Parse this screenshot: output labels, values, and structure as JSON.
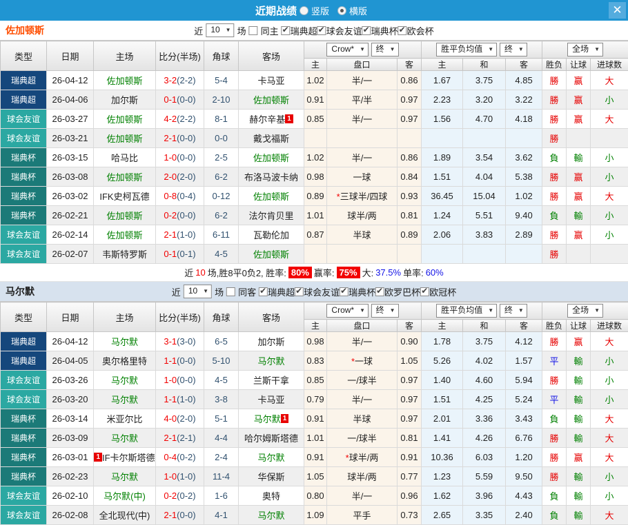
{
  "titlebar": {
    "title": "近期战绩",
    "vertical_label": "竖版",
    "horizontal_label": "横版",
    "selected_layout": "横版"
  },
  "icons": {
    "close": "✕",
    "dropdown": "▼"
  },
  "table_header": {
    "type": "类型",
    "date": "日期",
    "home": "主场",
    "score_half": "比分(半场)",
    "corner": "角球",
    "away": "客场",
    "sub_home": "主",
    "sub_handicap": "盘口",
    "sub_away": "客",
    "sub_avg_home": "主",
    "sub_avg_draw": "和",
    "sub_avg_away": "客",
    "sub_result": "胜负",
    "sub_let": "让球",
    "sub_goals": "进球数"
  },
  "dropdowns": {
    "crow": "Crow*",
    "final": "终",
    "avg": "胜平负均值",
    "full": "全场"
  },
  "type_colors": {
    "瑞典超": "#15477C",
    "球会友谊": "#2BA8A2",
    "瑞典杯": "#1B7A78"
  },
  "result_colors": {
    "勝": "#E60000",
    "平": "#1414E6",
    "負": "#008000",
    "赢": "#E60000",
    "輸": "#008000",
    "大": "#E60000",
    "小": "#008000"
  },
  "sections": [
    {
      "team": "佐加顿斯",
      "filter": {
        "prefix": "近",
        "count": "10",
        "suffix": "场",
        "same_label": "同主",
        "same_checked": false,
        "leagues": [
          {
            "label": "瑞典超",
            "checked": true
          },
          {
            "label": "球会友谊",
            "checked": true
          },
          {
            "label": "瑞典杯",
            "checked": true
          },
          {
            "label": "欧会杯",
            "checked": true
          }
        ]
      },
      "rows": [
        {
          "type": "瑞典超",
          "date": "26-04-12",
          "home": "佐加顿斯",
          "home_green": true,
          "home_badge": "",
          "home_badge_before": false,
          "score": "3-2",
          "half": "(2-2)",
          "corner": "5-4",
          "away": "卡马亚",
          "away_green": false,
          "away_badge": "",
          "odds_home": "1.02",
          "handicap": "半/一",
          "handicap_star": false,
          "odds_away": "0.86",
          "avg_home": "1.67",
          "avg_draw": "3.75",
          "avg_away": "4.85",
          "res_win": "勝",
          "res_let": "赢",
          "res_goals": "大"
        },
        {
          "type": "瑞典超",
          "date": "26-04-06",
          "home": "加尔斯",
          "home_green": false,
          "home_badge": "",
          "home_badge_before": false,
          "score": "0-1",
          "half": "(0-0)",
          "corner": "2-10",
          "away": "佐加顿斯",
          "away_green": true,
          "away_badge": "",
          "odds_home": "0.91",
          "handicap": "平/半",
          "handicap_star": false,
          "odds_away": "0.97",
          "avg_home": "2.23",
          "avg_draw": "3.20",
          "avg_away": "3.22",
          "res_win": "勝",
          "res_let": "赢",
          "res_goals": "小"
        },
        {
          "type": "球会友谊",
          "date": "26-03-27",
          "home": "佐加顿斯",
          "home_green": true,
          "home_badge": "",
          "home_badge_before": false,
          "score": "4-2",
          "half": "(2-2)",
          "corner": "8-1",
          "away": "赫尔辛基",
          "away_green": false,
          "away_badge": "1",
          "odds_home": "0.85",
          "handicap": "半/一",
          "handicap_star": false,
          "odds_away": "0.97",
          "avg_home": "1.56",
          "avg_draw": "4.70",
          "avg_away": "4.18",
          "res_win": "勝",
          "res_let": "赢",
          "res_goals": "大"
        },
        {
          "type": "球会友谊",
          "date": "26-03-21",
          "home": "佐加顿斯",
          "home_green": true,
          "home_badge": "",
          "home_badge_before": false,
          "score": "2-1",
          "half": "(0-0)",
          "corner": "0-0",
          "away": "戴戈福斯",
          "away_green": false,
          "away_badge": "",
          "odds_home": "",
          "handicap": "",
          "handicap_star": false,
          "odds_away": "",
          "avg_home": "",
          "avg_draw": "",
          "avg_away": "",
          "res_win": "勝",
          "res_let": "",
          "res_goals": ""
        },
        {
          "type": "瑞典杯",
          "date": "26-03-15",
          "home": "哈马比",
          "home_green": false,
          "home_badge": "",
          "home_badge_before": false,
          "score": "1-0",
          "half": "(0-0)",
          "corner": "2-5",
          "away": "佐加顿斯",
          "away_green": true,
          "away_badge": "",
          "odds_home": "1.02",
          "handicap": "半/一",
          "handicap_star": false,
          "odds_away": "0.86",
          "avg_home": "1.89",
          "avg_draw": "3.54",
          "avg_away": "3.62",
          "res_win": "負",
          "res_let": "輸",
          "res_goals": "小"
        },
        {
          "type": "瑞典杯",
          "date": "26-03-08",
          "home": "佐加顿斯",
          "home_green": true,
          "home_badge": "",
          "home_badge_before": false,
          "score": "2-0",
          "half": "(2-0)",
          "corner": "6-2",
          "away": "布洛马波卡纳",
          "away_green": false,
          "away_badge": "",
          "odds_home": "0.98",
          "handicap": "一球",
          "handicap_star": false,
          "odds_away": "0.84",
          "avg_home": "1.51",
          "avg_draw": "4.04",
          "avg_away": "5.38",
          "res_win": "勝",
          "res_let": "赢",
          "res_goals": "小"
        },
        {
          "type": "瑞典杯",
          "date": "26-03-02",
          "home": "IFK史柯瓦德",
          "home_green": false,
          "home_badge": "",
          "home_badge_before": false,
          "score": "0-8",
          "half": "(0-4)",
          "corner": "0-12",
          "away": "佐加顿斯",
          "away_green": true,
          "away_badge": "",
          "odds_home": "0.89",
          "handicap": "三球半/四球",
          "handicap_star": true,
          "odds_away": "0.93",
          "avg_home": "36.45",
          "avg_draw": "15.04",
          "avg_away": "1.02",
          "res_win": "勝",
          "res_let": "赢",
          "res_goals": "大"
        },
        {
          "type": "瑞典杯",
          "date": "26-02-21",
          "home": "佐加顿斯",
          "home_green": true,
          "home_badge": "",
          "home_badge_before": false,
          "score": "0-2",
          "half": "(0-0)",
          "corner": "6-2",
          "away": "法尔肯贝里",
          "away_green": false,
          "away_badge": "",
          "odds_home": "1.01",
          "handicap": "球半/两",
          "handicap_star": false,
          "odds_away": "0.81",
          "avg_home": "1.24",
          "avg_draw": "5.51",
          "avg_away": "9.40",
          "res_win": "負",
          "res_let": "輸",
          "res_goals": "小"
        },
        {
          "type": "球会友谊",
          "date": "26-02-14",
          "home": "佐加顿斯",
          "home_green": true,
          "home_badge": "",
          "home_badge_before": false,
          "score": "2-1",
          "half": "(1-0)",
          "corner": "6-11",
          "away": "瓦勒伦加",
          "away_green": false,
          "away_badge": "",
          "odds_home": "0.87",
          "handicap": "半球",
          "handicap_star": false,
          "odds_away": "0.89",
          "avg_home": "2.06",
          "avg_draw": "3.83",
          "avg_away": "2.89",
          "res_win": "勝",
          "res_let": "赢",
          "res_goals": "小"
        },
        {
          "type": "球会友谊",
          "date": "26-02-07",
          "home": "韦斯特罗斯",
          "home_green": false,
          "home_badge": "",
          "home_badge_before": false,
          "score": "0-1",
          "half": "(0-1)",
          "corner": "4-5",
          "away": "佐加顿斯",
          "away_green": true,
          "away_badge": "",
          "odds_home": "",
          "handicap": "",
          "handicap_star": false,
          "odds_away": "",
          "avg_home": "",
          "avg_draw": "",
          "avg_away": "",
          "res_win": "勝",
          "res_let": "",
          "res_goals": ""
        }
      ],
      "summary": {
        "t1": "近",
        "n1": "10",
        "t2": "场,胜8平0负2, 胜率:",
        "rate1": "80%",
        "t3": "赢率:",
        "rate2": "75%",
        "t4": "大:",
        "big": "37.5%",
        "t5": "单率:",
        "single": "60%"
      }
    },
    {
      "team": "马尔默",
      "filter": {
        "prefix": "近",
        "count": "10",
        "suffix": "场",
        "same_label": "同客",
        "same_checked": false,
        "leagues": [
          {
            "label": "瑞典超",
            "checked": true
          },
          {
            "label": "球会友谊",
            "checked": true
          },
          {
            "label": "瑞典杯",
            "checked": true
          },
          {
            "label": "欧罗巴杯",
            "checked": true
          },
          {
            "label": "欧冠杯",
            "checked": true
          }
        ]
      },
      "rows": [
        {
          "type": "瑞典超",
          "date": "26-04-12",
          "home": "马尔默",
          "home_green": true,
          "home_badge": "",
          "home_badge_before": false,
          "score": "3-1",
          "half": "(3-0)",
          "corner": "6-5",
          "away": "加尔斯",
          "away_green": false,
          "away_badge": "",
          "odds_home": "0.98",
          "handicap": "半/一",
          "handicap_star": false,
          "odds_away": "0.90",
          "avg_home": "1.78",
          "avg_draw": "3.75",
          "avg_away": "4.12",
          "res_win": "勝",
          "res_let": "赢",
          "res_goals": "大"
        },
        {
          "type": "瑞典超",
          "date": "26-04-05",
          "home": "奥尔格里特",
          "home_green": false,
          "home_badge": "",
          "home_badge_before": false,
          "score": "1-1",
          "half": "(0-0)",
          "corner": "5-10",
          "away": "马尔默",
          "away_green": true,
          "away_badge": "",
          "odds_home": "0.83",
          "handicap": "一球",
          "handicap_star": true,
          "odds_away": "1.05",
          "avg_home": "5.26",
          "avg_draw": "4.02",
          "avg_away": "1.57",
          "res_win": "平",
          "res_let": "輸",
          "res_goals": "小"
        },
        {
          "type": "球会友谊",
          "date": "26-03-26",
          "home": "马尔默",
          "home_green": true,
          "home_badge": "",
          "home_badge_before": false,
          "score": "1-0",
          "half": "(0-0)",
          "corner": "4-5",
          "away": "兰斯干拿",
          "away_green": false,
          "away_badge": "",
          "odds_home": "0.85",
          "handicap": "一/球半",
          "handicap_star": false,
          "odds_away": "0.97",
          "avg_home": "1.40",
          "avg_draw": "4.60",
          "avg_away": "5.94",
          "res_win": "勝",
          "res_let": "輸",
          "res_goals": "小"
        },
        {
          "type": "球会友谊",
          "date": "26-03-20",
          "home": "马尔默",
          "home_green": true,
          "home_badge": "",
          "home_badge_before": false,
          "score": "1-1",
          "half": "(1-0)",
          "corner": "3-8",
          "away": "卡马亚",
          "away_green": false,
          "away_badge": "",
          "odds_home": "0.79",
          "handicap": "半/一",
          "handicap_star": false,
          "odds_away": "0.97",
          "avg_home": "1.51",
          "avg_draw": "4.25",
          "avg_away": "5.24",
          "res_win": "平",
          "res_let": "輸",
          "res_goals": "小"
        },
        {
          "type": "瑞典杯",
          "date": "26-03-14",
          "home": "米亚尔比",
          "home_green": false,
          "home_badge": "",
          "home_badge_before": false,
          "score": "4-0",
          "half": "(2-0)",
          "corner": "5-1",
          "away": "马尔默",
          "away_green": true,
          "away_badge": "1",
          "odds_home": "0.91",
          "handicap": "半球",
          "handicap_star": false,
          "odds_away": "0.97",
          "avg_home": "2.01",
          "avg_draw": "3.36",
          "avg_away": "3.43",
          "res_win": "負",
          "res_let": "輸",
          "res_goals": "大"
        },
        {
          "type": "瑞典杯",
          "date": "26-03-09",
          "home": "马尔默",
          "home_green": true,
          "home_badge": "",
          "home_badge_before": false,
          "score": "2-1",
          "half": "(2-1)",
          "corner": "4-4",
          "away": "哈尔姆斯塔德",
          "away_green": false,
          "away_badge": "",
          "odds_home": "1.01",
          "handicap": "一/球半",
          "handicap_star": false,
          "odds_away": "0.81",
          "avg_home": "1.41",
          "avg_draw": "4.26",
          "avg_away": "6.76",
          "res_win": "勝",
          "res_let": "輸",
          "res_goals": "大"
        },
        {
          "type": "瑞典杯",
          "date": "26-03-01",
          "home": "IF卡尔斯塔德",
          "home_green": false,
          "home_badge": "1",
          "home_badge_before": true,
          "score": "0-4",
          "half": "(0-2)",
          "corner": "2-4",
          "away": "马尔默",
          "away_green": true,
          "away_badge": "",
          "odds_home": "0.91",
          "handicap": "球半/两",
          "handicap_star": true,
          "odds_away": "0.91",
          "avg_home": "10.36",
          "avg_draw": "6.03",
          "avg_away": "1.20",
          "res_win": "勝",
          "res_let": "赢",
          "res_goals": "大"
        },
        {
          "type": "瑞典杯",
          "date": "26-02-23",
          "home": "马尔默",
          "home_green": true,
          "home_badge": "",
          "home_badge_before": false,
          "score": "1-0",
          "half": "(1-0)",
          "corner": "11-4",
          "away": "华保斯",
          "away_green": false,
          "away_badge": "",
          "odds_home": "1.05",
          "handicap": "球半/两",
          "handicap_star": false,
          "odds_away": "0.77",
          "avg_home": "1.23",
          "avg_draw": "5.59",
          "avg_away": "9.50",
          "res_win": "勝",
          "res_let": "輸",
          "res_goals": "小"
        },
        {
          "type": "球会友谊",
          "date": "26-02-10",
          "home": "马尔默(中)",
          "home_green": true,
          "home_badge": "",
          "home_badge_before": false,
          "score": "0-2",
          "half": "(0-2)",
          "corner": "1-6",
          "away": "奥特",
          "away_green": false,
          "away_badge": "",
          "odds_home": "0.80",
          "handicap": "半/一",
          "handicap_star": false,
          "odds_away": "0.96",
          "avg_home": "1.62",
          "avg_draw": "3.96",
          "avg_away": "4.43",
          "res_win": "負",
          "res_let": "輸",
          "res_goals": "小"
        },
        {
          "type": "球会友谊",
          "date": "26-02-08",
          "home": "全北现代(中)",
          "home_green": false,
          "home_badge": "",
          "home_badge_before": false,
          "score": "2-1",
          "half": "(0-0)",
          "corner": "4-1",
          "away": "马尔默",
          "away_green": true,
          "away_badge": "",
          "odds_home": "1.09",
          "handicap": "平手",
          "handicap_star": false,
          "odds_away": "0.73",
          "avg_home": "2.65",
          "avg_draw": "3.35",
          "avg_away": "2.40",
          "res_win": "負",
          "res_let": "輸",
          "res_goals": "大"
        }
      ]
    }
  ]
}
